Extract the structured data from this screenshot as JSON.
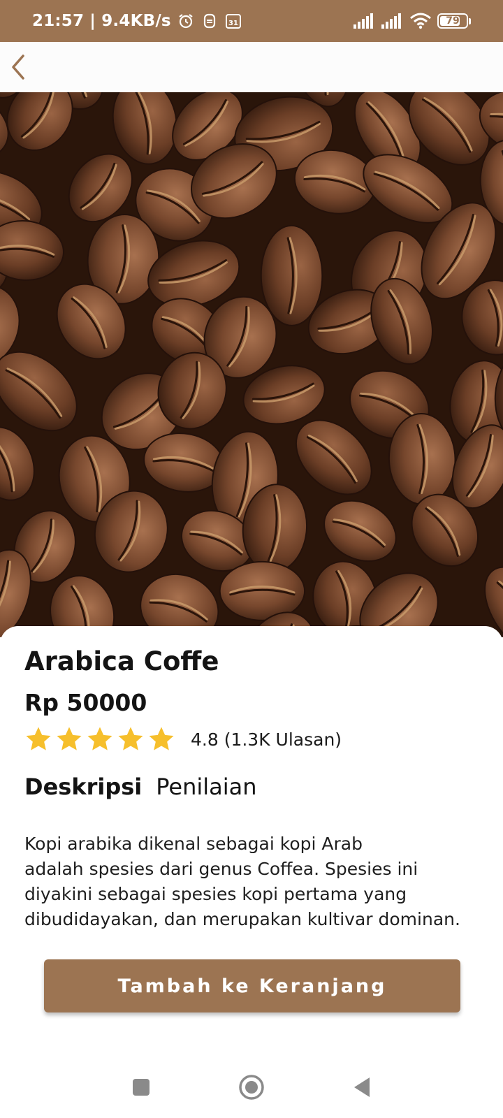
{
  "status_bar": {
    "time": "21:57 | 9.4KB/s",
    "battery": "79",
    "battery_level": 0.79,
    "icons": [
      "alarm-icon",
      "notification-icon",
      "calendar-icon",
      "signal-icon",
      "signal-icon",
      "wifi-icon",
      "battery-icon"
    ],
    "calendar_day": "31"
  },
  "app_bar": {
    "back_icon": "chevron-left-icon"
  },
  "product": {
    "image": "coffee-beans-photo",
    "title": "Arabica Coffe",
    "price": "Rp 50000",
    "rating_stars": 5,
    "rating_text": "4.8 (1.3K Ulasan)"
  },
  "tabs": [
    {
      "label": "Deskripsi",
      "active": true
    },
    {
      "label": "Penilaian",
      "active": false
    }
  ],
  "description": "Kopi arabika dikenal sebagai kopi Arab\nadalah spesies dari genus Coffea. Spesies ini\ndiyakini sebagai spesies kopi pertama yang\ndibudidayakan, dan merupakan kultivar dominan.",
  "cart_button_label": "Tambah ke Keranjang",
  "nav_bar": {
    "icons": [
      "recent-apps-icon",
      "home-icon",
      "back-icon"
    ]
  },
  "colors": {
    "accent": "#9c7452",
    "star": "#f6bf2c",
    "text": "#141414"
  }
}
